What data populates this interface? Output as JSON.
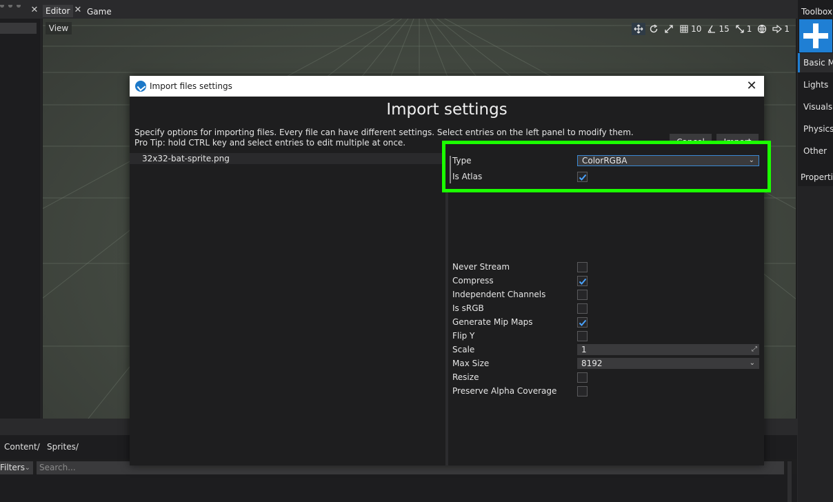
{
  "tabs": {
    "editor": "Editor",
    "game": "Game"
  },
  "viewport": {
    "view_label": "View",
    "grid_snap": "10",
    "rotate_snap": "15",
    "scale_snap": "1",
    "camera_speed": "1"
  },
  "toolbox": {
    "title": "Toolbox",
    "items": [
      "Basic Models",
      "Lights",
      "Visuals",
      "Physics",
      "Other"
    ],
    "properties_label": "Properties"
  },
  "content": {
    "breadcrumb": [
      "Content/",
      "Sprites/"
    ],
    "filters_label": "Filters",
    "search_placeholder": "Search..."
  },
  "dialog": {
    "window_title": "Import files settings",
    "heading": "Import settings",
    "description_line1": "Specify options for importing files. Every file can have different settings. Select entries on the left panel to modify them.",
    "description_line2": "Pro Tip: hold CTRL key and select entries to edit multiple at once.",
    "cancel_label": "Cancel",
    "import_label": "Import",
    "files": [
      "32x32-bat-sprite.png"
    ],
    "properties": {
      "type_label": "Type",
      "type_value": "ColorRGBA",
      "is_atlas_label": "Is Atlas",
      "never_stream_label": "Never Stream",
      "compress_label": "Compress",
      "independent_channels_label": "Independent Channels",
      "is_srgb_label": "Is sRGB",
      "generate_mip_maps_label": "Generate Mip Maps",
      "flip_y_label": "Flip Y",
      "scale_label": "Scale",
      "scale_value": "1",
      "max_size_label": "Max Size",
      "max_size_value": "8192",
      "resize_label": "Resize",
      "preserve_alpha_label": "Preserve Alpha Coverage"
    },
    "checks": {
      "is_atlas": true,
      "never_stream": false,
      "compress": true,
      "independent_channels": false,
      "is_srgb": false,
      "generate_mip_maps": true,
      "flip_y": false,
      "resize": false,
      "preserve_alpha": false
    }
  },
  "colors": {
    "accent": "#1f7fd4",
    "highlight": "#1bff00",
    "check": "#4aa3ff"
  }
}
